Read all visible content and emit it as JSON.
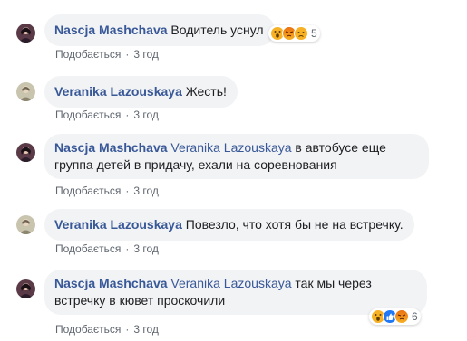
{
  "comments": [
    {
      "author": "Nascja Mashchava",
      "mention": "",
      "text": "Водитель уснул",
      "like_label": "Подобається",
      "time": "3 год",
      "reactions_count": "5",
      "reactions": [
        "wow",
        "angry",
        "sad"
      ]
    },
    {
      "author": "Veranika Lazouskaya",
      "mention": "",
      "text": "Жесть!",
      "like_label": "Подобається",
      "time": "3 год"
    },
    {
      "author": "Nascja Mashchava",
      "mention": "Veranika Lazouskaya",
      "text": "в автобусе еще группа детей в придачу, ехали на соревнования",
      "like_label": "Подобається",
      "time": "3 год"
    },
    {
      "author": "Veranika Lazouskaya",
      "mention": "",
      "text": "Повезло, что хотя бы не на встречку.",
      "like_label": "Подобається",
      "time": "3 год"
    },
    {
      "author": "Nascja Mashchava",
      "mention": "Veranika Lazouskaya",
      "text": "так мы через встречку в кювет проскочили",
      "like_label": "Подобається",
      "time": "3 год",
      "reactions_count": "6",
      "reactions": [
        "wow",
        "like",
        "angry"
      ]
    }
  ],
  "colors": {
    "author": "#385898",
    "bubble": "#f2f3f5",
    "meta": "#606770"
  }
}
